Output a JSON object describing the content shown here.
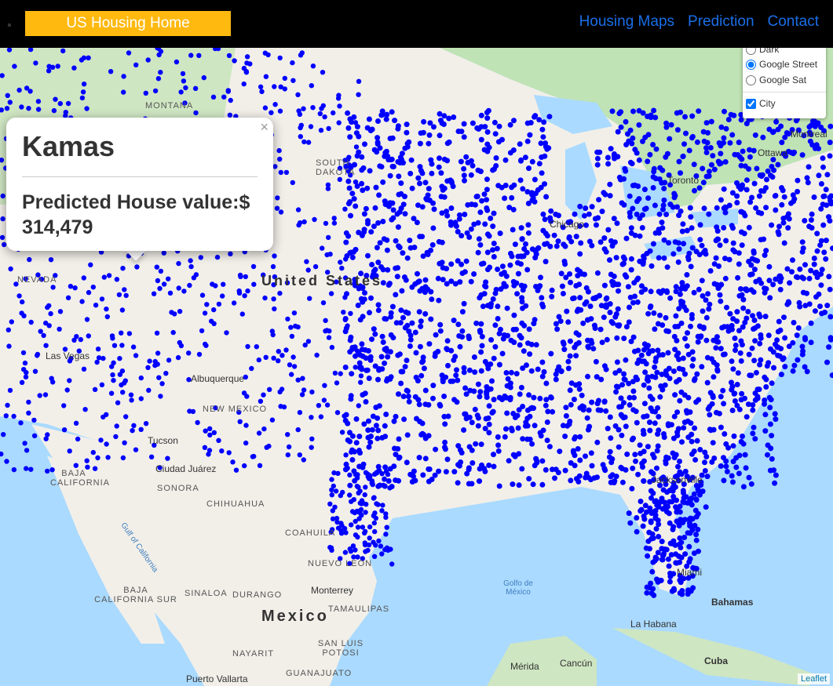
{
  "nav": {
    "home": "US Housing Home",
    "links": [
      "Housing Maps",
      "Prediction",
      "Contact"
    ]
  },
  "layers": {
    "base": [
      "Dark",
      "Google Street",
      "Google Sat"
    ],
    "selected": "Google Street",
    "overlay": "City",
    "overlay_checked": true
  },
  "popup": {
    "title": "Kamas",
    "body": "Predicted House value:$ 314,479",
    "close": "×"
  },
  "map_labels": {
    "states": [
      "MONTANA",
      "SOUTH DAKOTA",
      "NEVADA",
      "NEW MEXICO",
      "BAJA CALIFORNIA",
      "SONORA",
      "CHIHUAHUA",
      "COAHUILA",
      "NUEVO LEON",
      "BAJA CALIFORNIA SUR",
      "SINALOA",
      "DURANGO",
      "TAMAULIPAS",
      "SAN LUIS POTOSI",
      "NAYARIT",
      "GUANAJUATO"
    ],
    "cities": [
      "Toronto",
      "Ottawa",
      "Montreal",
      "Chicago",
      "Las Vegas",
      "Albuquerque",
      "Tucson",
      "Ciudad Juárez",
      "Monterrey",
      "Jacksonville",
      "Miami",
      "Bahamas",
      "La Habana",
      "Cuba",
      "Cancún",
      "Mérida",
      "Puerto Vallarta",
      "Gulf of California",
      "Golfo de México"
    ],
    "countries": [
      "United States",
      "Mexico"
    ]
  },
  "attribution": "Leaflet",
  "colors": {
    "marker": "#0000ff",
    "home_button": "#ffb90f",
    "nav_link": "#1a6ee8",
    "water": "#aadaff",
    "land": "#f2efe9",
    "green": "#bfe3b4"
  }
}
